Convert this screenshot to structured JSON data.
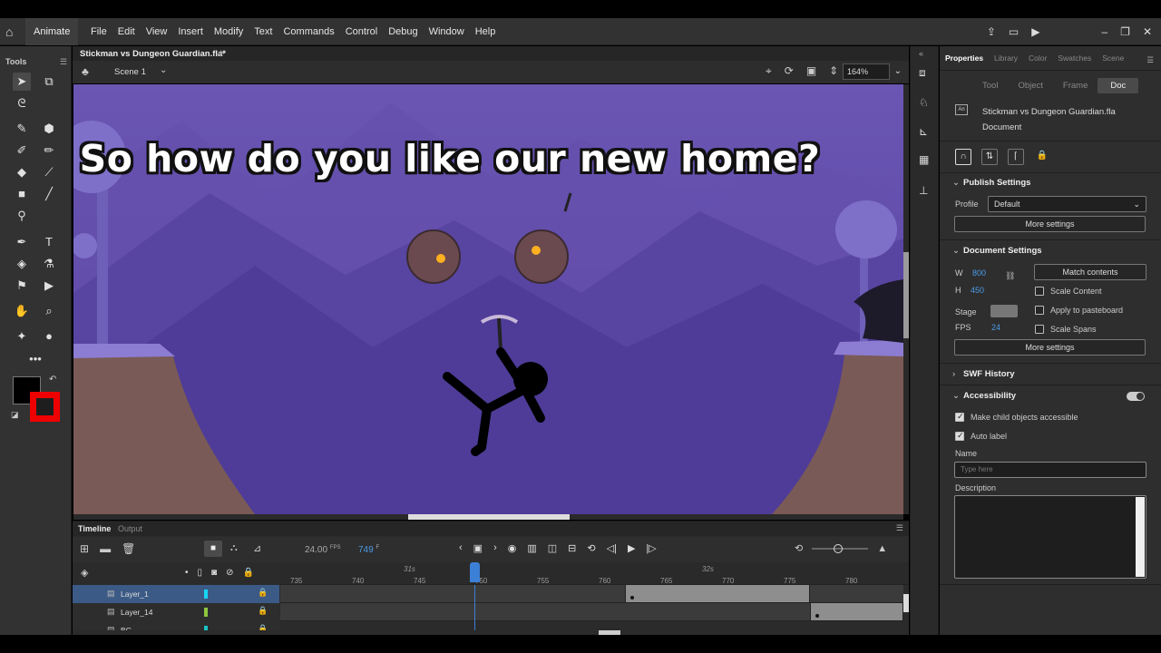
{
  "app": {
    "name": "Animate"
  },
  "menu": [
    "File",
    "Edit",
    "View",
    "Insert",
    "Modify",
    "Text",
    "Commands",
    "Control",
    "Debug",
    "Window",
    "Help"
  ],
  "tools": {
    "title": "Tools",
    "more": "•••"
  },
  "document": {
    "tab_title": "Stickman vs Dungeon Guardian.fla*",
    "scene": "Scene 1",
    "zoom": "164%"
  },
  "stage": {
    "caption": "So how do you like our new home?",
    "bg_color": "#5a47a6"
  },
  "timeline": {
    "tabs": [
      "Timeline",
      "Output"
    ],
    "fps": "24.00",
    "fps_unit": "FPS",
    "frame": "749",
    "frame_unit": "F",
    "seconds": [
      "31s",
      "32s"
    ],
    "ticks": [
      "735",
      "740",
      "745",
      "750",
      "755",
      "760",
      "765",
      "770",
      "775",
      "780"
    ],
    "layers": [
      {
        "name": "Layer_1",
        "color": "#19d5f5",
        "selected": true
      },
      {
        "name": "Layer_14",
        "color": "#8dc63f",
        "selected": false
      },
      {
        "name": "BG",
        "color": "#19c4c4",
        "selected": false
      }
    ]
  },
  "properties": {
    "tabs": [
      "Properties",
      "Library",
      "Color",
      "Swatches",
      "Scene"
    ],
    "subtabs": [
      "Tool",
      "Object",
      "Frame",
      "Doc"
    ],
    "file_name": "Stickman vs Dungeon Guardian.fla",
    "doc_label": "Document",
    "publish": {
      "title": "Publish Settings",
      "profile_label": "Profile",
      "profile_value": "Default",
      "more": "More settings"
    },
    "doc_settings": {
      "title": "Document Settings",
      "w_label": "W",
      "w": "800",
      "h_label": "H",
      "h": "450",
      "match": "Match contents",
      "scale_content": "Scale Content",
      "stage_label": "Stage",
      "apply_pasteboard": "Apply to pasteboard",
      "fps_label": "FPS",
      "fps": "24",
      "scale_spans": "Scale Spans",
      "more": "More settings"
    },
    "swf_history": "SWF History",
    "accessibility": {
      "title": "Accessibility",
      "make_child": "Make child objects accessible",
      "auto_label": "Auto label",
      "name_label": "Name",
      "name_placeholder": "Type here",
      "desc_label": "Description"
    }
  }
}
